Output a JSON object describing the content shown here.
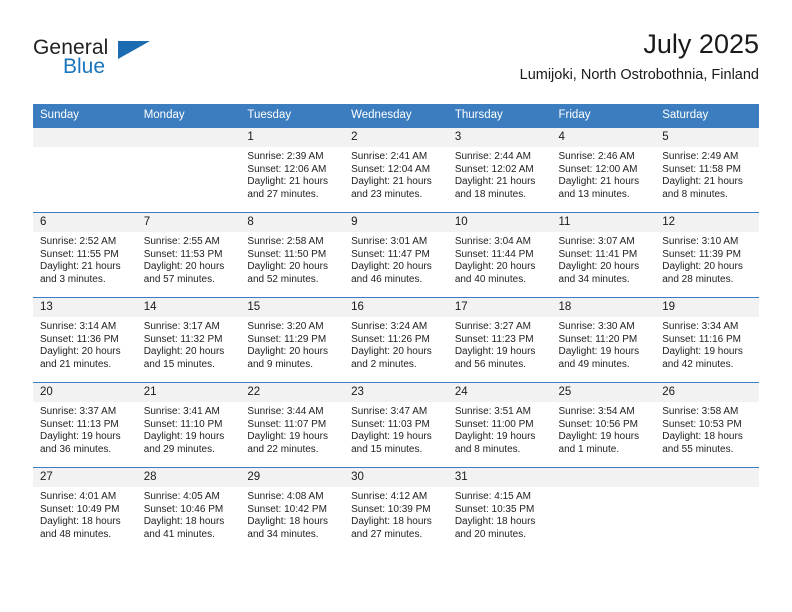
{
  "brand": {
    "name_top": "General",
    "name_bottom": "Blue",
    "accent_color": "#1b75bc",
    "triangle_color": "#1b6cb0"
  },
  "header": {
    "title": "July 2025",
    "subtitle": "Lumijoki, North Ostrobothnia, Finland"
  },
  "calendar": {
    "header_bg": "#3b7dbf",
    "date_band_bg": "#f2f2f2",
    "weekdays": [
      "Sunday",
      "Monday",
      "Tuesday",
      "Wednesday",
      "Thursday",
      "Friday",
      "Saturday"
    ],
    "weeks": [
      [
        {
          "day": "",
          "sunrise": "",
          "sunset": "",
          "daylight_line1": "",
          "daylight_line2": ""
        },
        {
          "day": "",
          "sunrise": "",
          "sunset": "",
          "daylight_line1": "",
          "daylight_line2": ""
        },
        {
          "day": "1",
          "sunrise": "Sunrise: 2:39 AM",
          "sunset": "Sunset: 12:06 AM",
          "daylight_line1": "Daylight: 21 hours",
          "daylight_line2": "and 27 minutes."
        },
        {
          "day": "2",
          "sunrise": "Sunrise: 2:41 AM",
          "sunset": "Sunset: 12:04 AM",
          "daylight_line1": "Daylight: 21 hours",
          "daylight_line2": "and 23 minutes."
        },
        {
          "day": "3",
          "sunrise": "Sunrise: 2:44 AM",
          "sunset": "Sunset: 12:02 AM",
          "daylight_line1": "Daylight: 21 hours",
          "daylight_line2": "and 18 minutes."
        },
        {
          "day": "4",
          "sunrise": "Sunrise: 2:46 AM",
          "sunset": "Sunset: 12:00 AM",
          "daylight_line1": "Daylight: 21 hours",
          "daylight_line2": "and 13 minutes."
        },
        {
          "day": "5",
          "sunrise": "Sunrise: 2:49 AM",
          "sunset": "Sunset: 11:58 PM",
          "daylight_line1": "Daylight: 21 hours",
          "daylight_line2": "and 8 minutes."
        }
      ],
      [
        {
          "day": "6",
          "sunrise": "Sunrise: 2:52 AM",
          "sunset": "Sunset: 11:55 PM",
          "daylight_line1": "Daylight: 21 hours",
          "daylight_line2": "and 3 minutes."
        },
        {
          "day": "7",
          "sunrise": "Sunrise: 2:55 AM",
          "sunset": "Sunset: 11:53 PM",
          "daylight_line1": "Daylight: 20 hours",
          "daylight_line2": "and 57 minutes."
        },
        {
          "day": "8",
          "sunrise": "Sunrise: 2:58 AM",
          "sunset": "Sunset: 11:50 PM",
          "daylight_line1": "Daylight: 20 hours",
          "daylight_line2": "and 52 minutes."
        },
        {
          "day": "9",
          "sunrise": "Sunrise: 3:01 AM",
          "sunset": "Sunset: 11:47 PM",
          "daylight_line1": "Daylight: 20 hours",
          "daylight_line2": "and 46 minutes."
        },
        {
          "day": "10",
          "sunrise": "Sunrise: 3:04 AM",
          "sunset": "Sunset: 11:44 PM",
          "daylight_line1": "Daylight: 20 hours",
          "daylight_line2": "and 40 minutes."
        },
        {
          "day": "11",
          "sunrise": "Sunrise: 3:07 AM",
          "sunset": "Sunset: 11:41 PM",
          "daylight_line1": "Daylight: 20 hours",
          "daylight_line2": "and 34 minutes."
        },
        {
          "day": "12",
          "sunrise": "Sunrise: 3:10 AM",
          "sunset": "Sunset: 11:39 PM",
          "daylight_line1": "Daylight: 20 hours",
          "daylight_line2": "and 28 minutes."
        }
      ],
      [
        {
          "day": "13",
          "sunrise": "Sunrise: 3:14 AM",
          "sunset": "Sunset: 11:36 PM",
          "daylight_line1": "Daylight: 20 hours",
          "daylight_line2": "and 21 minutes."
        },
        {
          "day": "14",
          "sunrise": "Sunrise: 3:17 AM",
          "sunset": "Sunset: 11:32 PM",
          "daylight_line1": "Daylight: 20 hours",
          "daylight_line2": "and 15 minutes."
        },
        {
          "day": "15",
          "sunrise": "Sunrise: 3:20 AM",
          "sunset": "Sunset: 11:29 PM",
          "daylight_line1": "Daylight: 20 hours",
          "daylight_line2": "and 9 minutes."
        },
        {
          "day": "16",
          "sunrise": "Sunrise: 3:24 AM",
          "sunset": "Sunset: 11:26 PM",
          "daylight_line1": "Daylight: 20 hours",
          "daylight_line2": "and 2 minutes."
        },
        {
          "day": "17",
          "sunrise": "Sunrise: 3:27 AM",
          "sunset": "Sunset: 11:23 PM",
          "daylight_line1": "Daylight: 19 hours",
          "daylight_line2": "and 56 minutes."
        },
        {
          "day": "18",
          "sunrise": "Sunrise: 3:30 AM",
          "sunset": "Sunset: 11:20 PM",
          "daylight_line1": "Daylight: 19 hours",
          "daylight_line2": "and 49 minutes."
        },
        {
          "day": "19",
          "sunrise": "Sunrise: 3:34 AM",
          "sunset": "Sunset: 11:16 PM",
          "daylight_line1": "Daylight: 19 hours",
          "daylight_line2": "and 42 minutes."
        }
      ],
      [
        {
          "day": "20",
          "sunrise": "Sunrise: 3:37 AM",
          "sunset": "Sunset: 11:13 PM",
          "daylight_line1": "Daylight: 19 hours",
          "daylight_line2": "and 36 minutes."
        },
        {
          "day": "21",
          "sunrise": "Sunrise: 3:41 AM",
          "sunset": "Sunset: 11:10 PM",
          "daylight_line1": "Daylight: 19 hours",
          "daylight_line2": "and 29 minutes."
        },
        {
          "day": "22",
          "sunrise": "Sunrise: 3:44 AM",
          "sunset": "Sunset: 11:07 PM",
          "daylight_line1": "Daylight: 19 hours",
          "daylight_line2": "and 22 minutes."
        },
        {
          "day": "23",
          "sunrise": "Sunrise: 3:47 AM",
          "sunset": "Sunset: 11:03 PM",
          "daylight_line1": "Daylight: 19 hours",
          "daylight_line2": "and 15 minutes."
        },
        {
          "day": "24",
          "sunrise": "Sunrise: 3:51 AM",
          "sunset": "Sunset: 11:00 PM",
          "daylight_line1": "Daylight: 19 hours",
          "daylight_line2": "and 8 minutes."
        },
        {
          "day": "25",
          "sunrise": "Sunrise: 3:54 AM",
          "sunset": "Sunset: 10:56 PM",
          "daylight_line1": "Daylight: 19 hours",
          "daylight_line2": "and 1 minute."
        },
        {
          "day": "26",
          "sunrise": "Sunrise: 3:58 AM",
          "sunset": "Sunset: 10:53 PM",
          "daylight_line1": "Daylight: 18 hours",
          "daylight_line2": "and 55 minutes."
        }
      ],
      [
        {
          "day": "27",
          "sunrise": "Sunrise: 4:01 AM",
          "sunset": "Sunset: 10:49 PM",
          "daylight_line1": "Daylight: 18 hours",
          "daylight_line2": "and 48 minutes."
        },
        {
          "day": "28",
          "sunrise": "Sunrise: 4:05 AM",
          "sunset": "Sunset: 10:46 PM",
          "daylight_line1": "Daylight: 18 hours",
          "daylight_line2": "and 41 minutes."
        },
        {
          "day": "29",
          "sunrise": "Sunrise: 4:08 AM",
          "sunset": "Sunset: 10:42 PM",
          "daylight_line1": "Daylight: 18 hours",
          "daylight_line2": "and 34 minutes."
        },
        {
          "day": "30",
          "sunrise": "Sunrise: 4:12 AM",
          "sunset": "Sunset: 10:39 PM",
          "daylight_line1": "Daylight: 18 hours",
          "daylight_line2": "and 27 minutes."
        },
        {
          "day": "31",
          "sunrise": "Sunrise: 4:15 AM",
          "sunset": "Sunset: 10:35 PM",
          "daylight_line1": "Daylight: 18 hours",
          "daylight_line2": "and 20 minutes."
        },
        {
          "day": "",
          "sunrise": "",
          "sunset": "",
          "daylight_line1": "",
          "daylight_line2": ""
        },
        {
          "day": "",
          "sunrise": "",
          "sunset": "",
          "daylight_line1": "",
          "daylight_line2": ""
        }
      ]
    ]
  }
}
